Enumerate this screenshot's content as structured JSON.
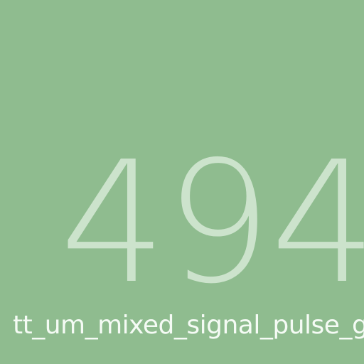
{
  "tile": {
    "background_color": "#8fbc8f",
    "number": "494",
    "number_color": "#cce3cc",
    "project_name": "tt_um_mixed_signal_pulse_g",
    "project_name_color": "#f5fbf5"
  }
}
